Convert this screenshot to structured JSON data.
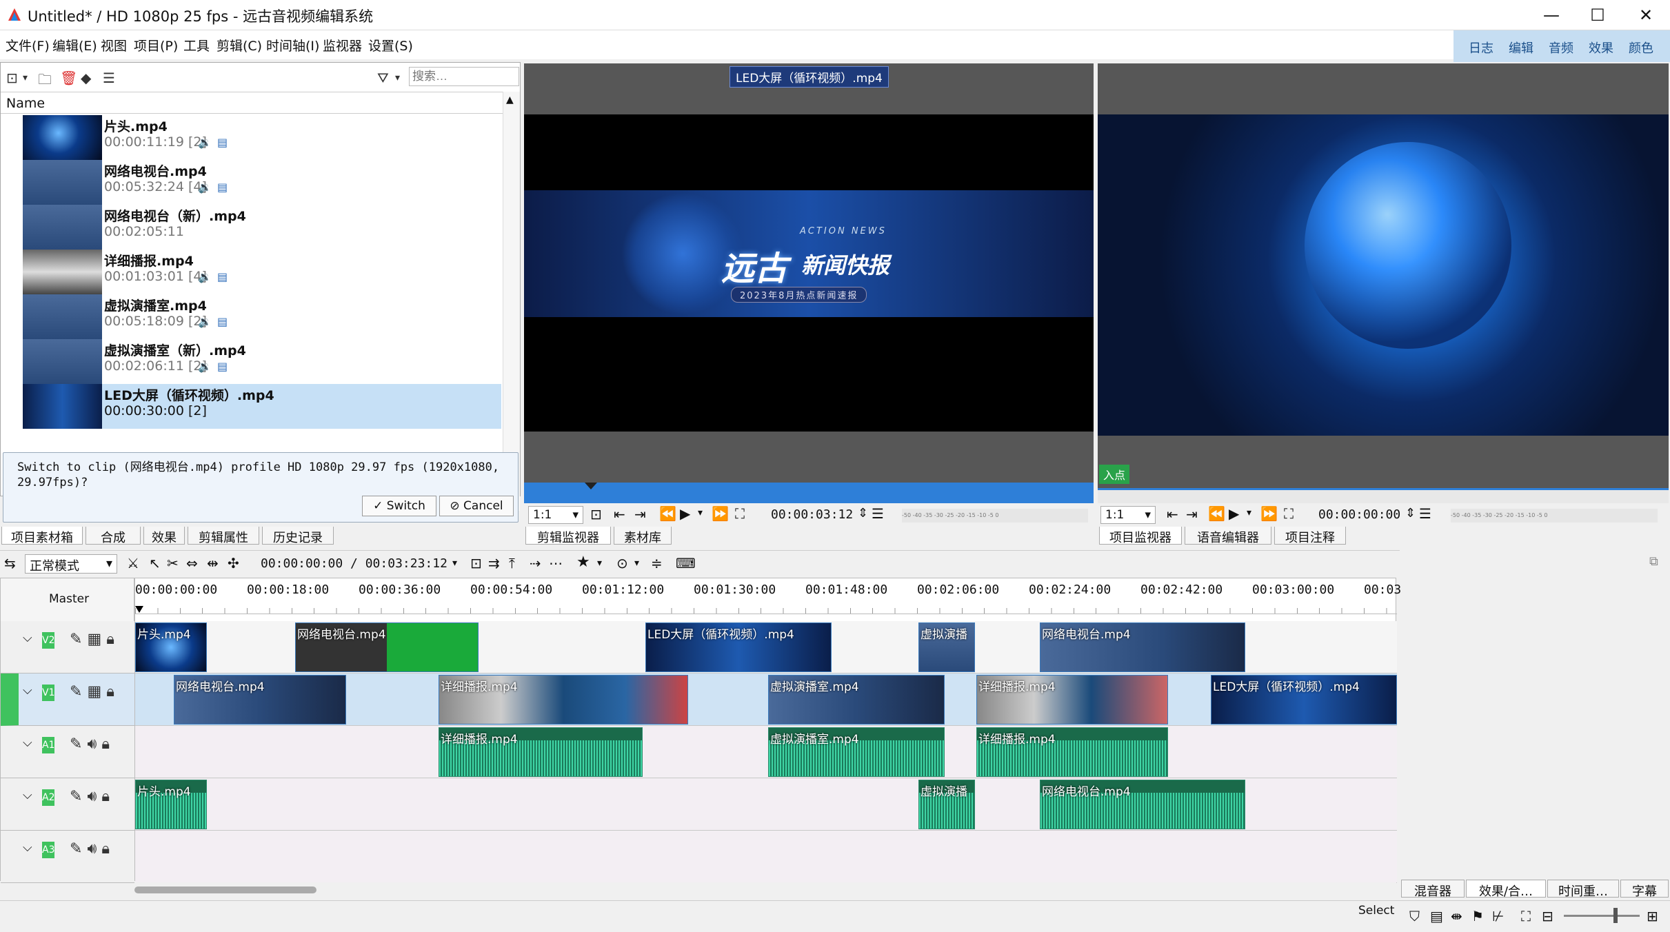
{
  "window": {
    "title": "Untitled* / HD 1080p 25 fps - 远古音视频编辑系统",
    "minimize": "—",
    "maximize": "☐",
    "close": "✕"
  },
  "menu": [
    "文件(F)",
    "编辑(E)",
    "视图",
    "项目(P)",
    "工具",
    "剪辑(C)",
    "时间轴(I)",
    "监视器",
    "设置(S)"
  ],
  "layouts": [
    "日志",
    "编辑",
    "音频",
    "效果",
    "颜色"
  ],
  "bin": {
    "search_placeholder": "搜索…",
    "column": "Name",
    "clips": [
      {
        "name": "片头.mp4",
        "duration": "00:00:11:19 [2]",
        "audio": true,
        "video": true
      },
      {
        "name": "网络电视台.mp4",
        "duration": "00:05:32:24 [4]",
        "audio": true,
        "video": true
      },
      {
        "name": "网络电视台（新）.mp4",
        "duration": "00:02:05:11",
        "audio": false,
        "video": false
      },
      {
        "name": "详细播报.mp4",
        "duration": "00:01:03:01 [4]",
        "audio": true,
        "video": true
      },
      {
        "name": "虚拟演播室.mp4",
        "duration": "00:05:18:09 [2]",
        "audio": true,
        "video": true
      },
      {
        "name": "虚拟演播室（新）.mp4",
        "duration": "00:02:06:11 [2]",
        "audio": true,
        "video": true
      },
      {
        "name": "LED大屏（循环视频）.mp4",
        "duration": "00:00:30:00 [2]",
        "audio": false,
        "video": false,
        "selected": true
      }
    ]
  },
  "dialog": {
    "message": "Switch to clip (网络电视台.mp4) profile HD 1080p 29.97 fps (1920x1080, 29.97fps)?",
    "switch_label": "Switch",
    "cancel_label": "Cancel"
  },
  "left_tabs": [
    "项目素材箱",
    "合成",
    "效果",
    "剪辑属性",
    "历史记录"
  ],
  "clip_monitor": {
    "clip_label": "LED大屏（循环视频）.mp4",
    "zoom": "1:1",
    "timecode": "00:00:03:12",
    "logo_main": "远古",
    "logo_sub": "新闻快报",
    "logo_en": "ACTION NEWS",
    "logo_line": "2023年8月热点新闻速报",
    "tabs": [
      "剪辑监视器",
      "素材库"
    ],
    "meter": "-50 -40 -35 -30 -25 -20 -15 -10 -5 0"
  },
  "project_monitor": {
    "zoom": "1:1",
    "timecode": "00:00:00:00",
    "in_point": "入点",
    "tabs": [
      "项目监视器",
      "语音编辑器",
      "项目注释"
    ],
    "meter": "-50 -40 -35 -30 -25 -20 -15 -10 -5 0"
  },
  "timeline": {
    "mode": "正常模式",
    "position": "00:00:00:00 / 00:03:23:12",
    "master": "Master",
    "ticks": [
      "00:00:00:00",
      "00:00:18:00",
      "00:00:36:00",
      "00:00:54:00",
      "00:01:12:00",
      "00:01:30:00",
      "00:01:48:00",
      "00:02:06:00",
      "00:02:24:00",
      "00:02:42:00",
      "00:03:00:00",
      "00:03"
    ],
    "tracks": [
      "V2",
      "V1",
      "A1",
      "A2",
      "A3"
    ],
    "clips_v2": [
      "片头.mp4",
      "网络电视台.mp4",
      "LED大屏（循环视频）.mp4",
      "虚拟演播",
      "网络电视台.mp4"
    ],
    "clips_v1": [
      "网络电视台.mp4",
      "详细播报.mp4",
      "虚拟演播室.mp4",
      "详细播报.mp4",
      "LED大屏（循环视频）.mp4"
    ],
    "clips_a1": [
      "详细播报.mp4",
      "虚拟演播室.mp4",
      "详细播报.mp4"
    ],
    "clips_a2": [
      "片头.mp4",
      "虚拟演播",
      "网络电视台.mp4"
    ]
  },
  "right_tabs": [
    "混音器",
    "效果/合…",
    "时间重…",
    "字幕"
  ],
  "status": {
    "select": "Select"
  },
  "colors": {
    "accent": "#1e88e5",
    "track_green": "#3fc25e",
    "audio": "#1a6a4a",
    "layout_bar": "#c5ddf2"
  }
}
